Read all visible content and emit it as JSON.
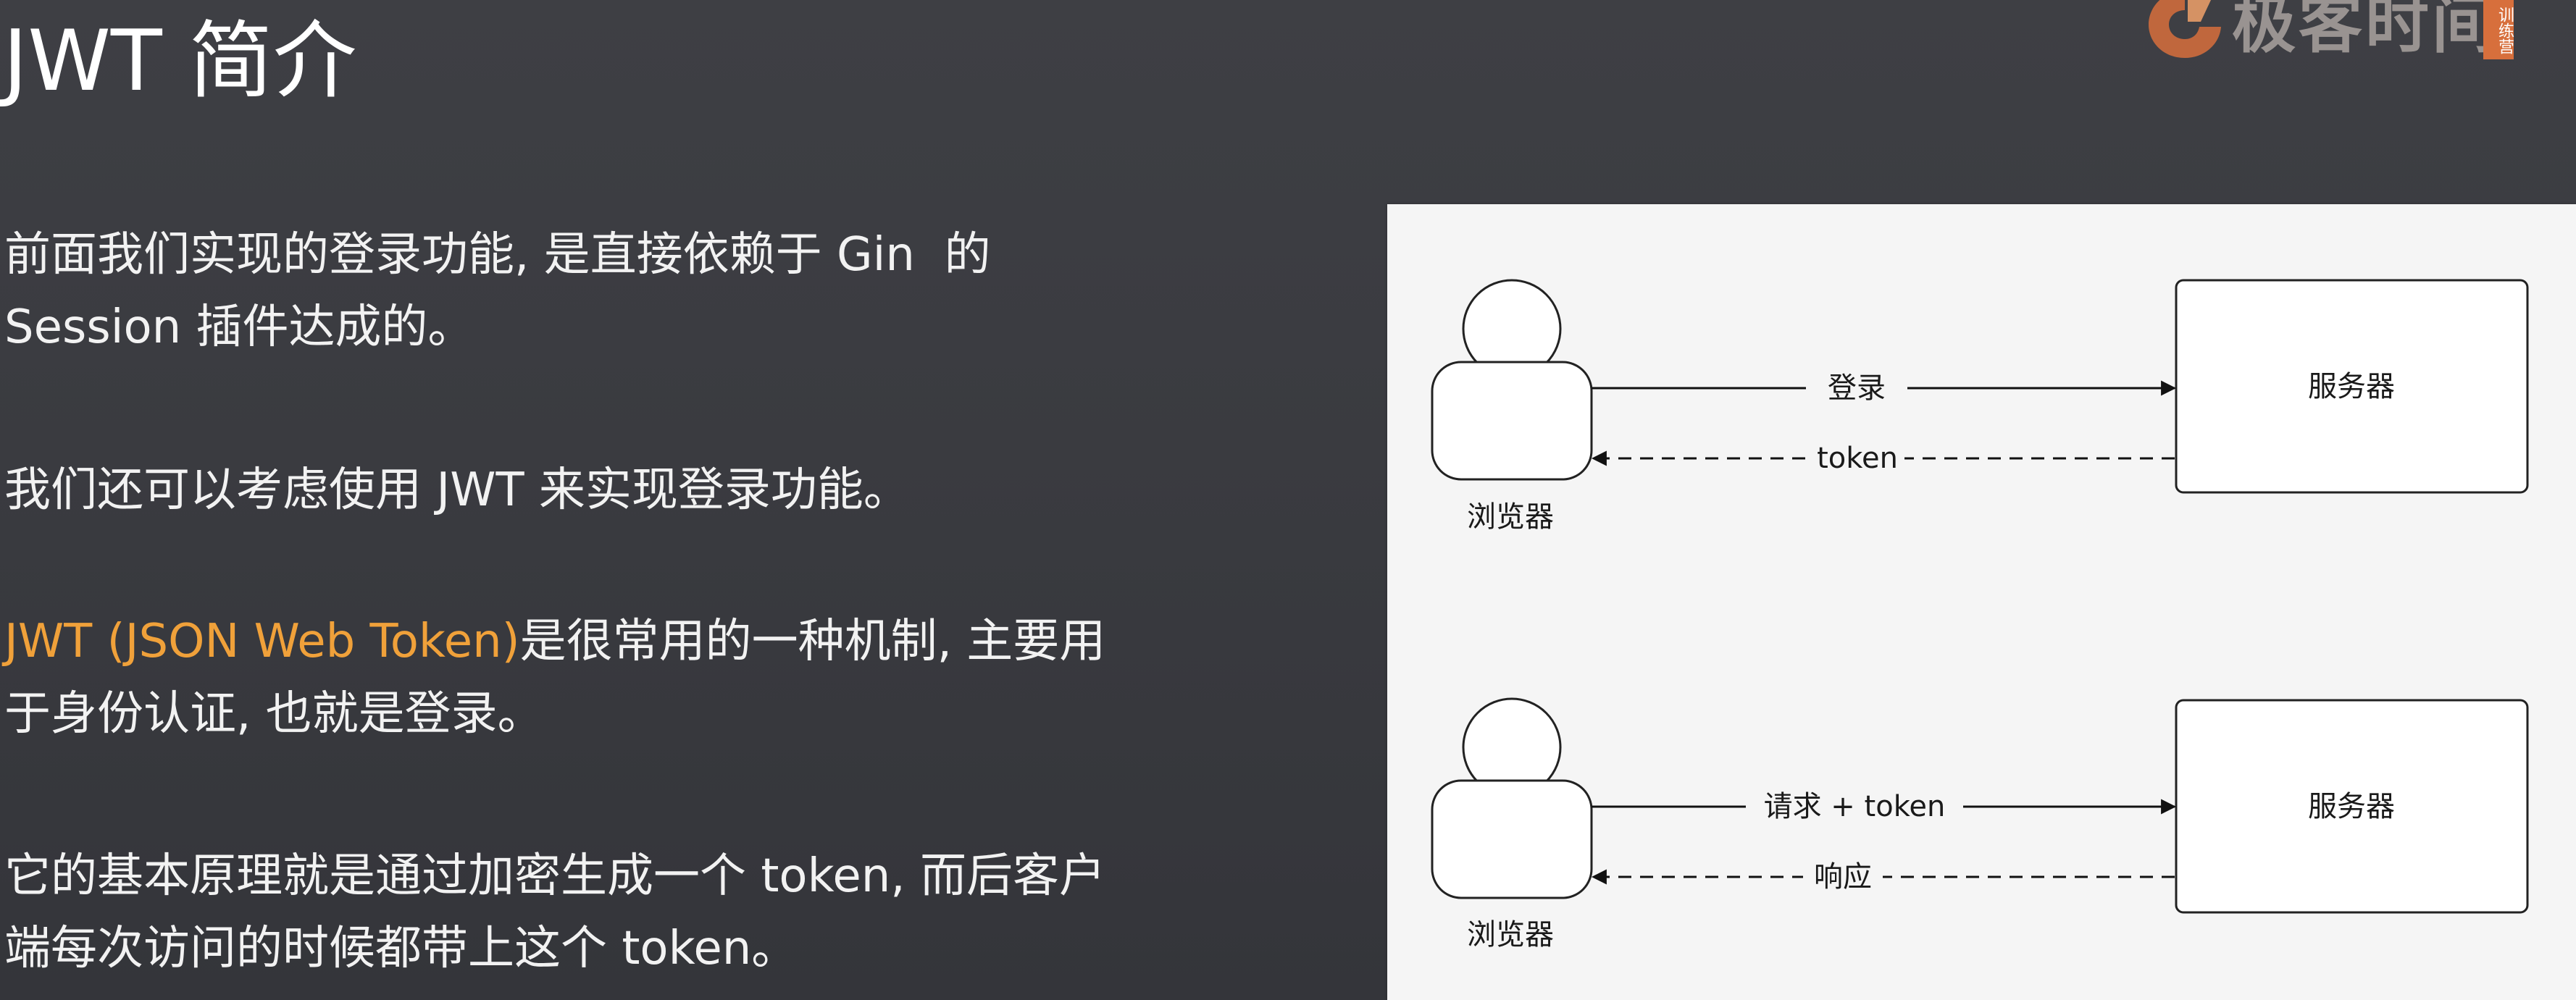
{
  "slide": {
    "title": "JWT 简介"
  },
  "brand": {
    "name": "极客时间",
    "badge": "训练营",
    "accent_color": "#d76f3c"
  },
  "content": {
    "paragraph1_line1": "前面我们实现的登录功能, 是直接依赖于 Gin  的",
    "paragraph1_line2": "Session 插件达成的。",
    "paragraph2": "我们还可以考虑使用 JWT 来实现登录功能。",
    "paragraph3_highlight": "JWT (JSON Web Token)",
    "paragraph3_line1_rest": "是很常用的一种机制, 主要用",
    "paragraph3_line2": "于身份认证, 也就是登录。",
    "paragraph4_line1": "它的基本原理就是通过加密生成一个 token, 而后客户",
    "paragraph4_line2": "端每次访问的时候都带上这个 token。",
    "highlight_color": "#f0a13a"
  },
  "diagram": {
    "top_flow": {
      "client_label": "浏览器",
      "server_label": "服务器",
      "request_label": "登录",
      "response_label": "token"
    },
    "bottom_flow": {
      "client_label": "浏览器",
      "server_label": "服务器",
      "request_label": "请求 + token",
      "response_label": "响应"
    }
  }
}
